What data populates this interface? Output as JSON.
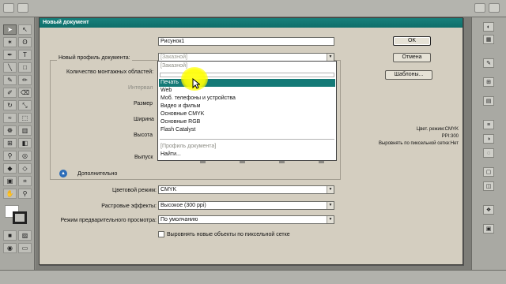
{
  "dialog": {
    "title": "Новый документ",
    "name_label": "Имя:",
    "name_value": "Рисунок1",
    "profile_label": "Новый профиль документа:",
    "profile_value": "[Заказной]",
    "artboards_label": "Количество монтажных областей:",
    "interval_label": "Интервал",
    "size_label": "Размер",
    "width_label": "Ширина",
    "height_label": "Высота",
    "bleed_label": "Выпуск",
    "advanced_label": "Дополнительно",
    "color_mode_label": "Цветовой режим:",
    "color_mode_value": "CMYK",
    "raster_label": "Растровые эффекты:",
    "raster_value": "Высокое (300 ppi)",
    "preview_label": "Режим предварительного просмотра:",
    "preview_value": "По умолчанию",
    "align_checkbox_label": "Выровнять новые объекты по пиксельной сетке",
    "align_checked": false,
    "ok_button": "OK",
    "cancel_button": "Отмена",
    "templates_button": "Шаблоны...",
    "info": {
      "color_mode": "Цвет. режим:CMYK",
      "ppi": "PPI:300",
      "pixel_grid": "Выровнять по пиксельной сетке:Нет"
    }
  },
  "dropdown": {
    "header": "[Заказной]",
    "search_value": "",
    "items": [
      "Печать",
      "Web",
      "Моб. телефоны и устройства",
      "Видео и фильм",
      "Основные CMYK",
      "Основные RGB",
      "Flash Catalyst"
    ],
    "selected_item": "Печать",
    "footer_items": [
      "[Профиль документа]",
      "Найти..."
    ]
  },
  "tools": [
    "select-arrow",
    "direct-select",
    "magic-wand",
    "lasso",
    "pen",
    "type",
    "line",
    "rectangle",
    "paintbrush",
    "pencil",
    "blob-brush",
    "eraser",
    "rotate",
    "scale",
    "warp",
    "free-transform",
    "symbol-sprayer",
    "graph",
    "mesh",
    "gradient",
    "eyedropper",
    "blend",
    "live-paint",
    "live-paint-select",
    "artboard",
    "slice",
    "hand",
    "zoom"
  ],
  "colors": {
    "dialog_bg": "#d4cec0",
    "titlebar": "#127470",
    "selection": "#157a77",
    "highlight": "#ffff00"
  }
}
